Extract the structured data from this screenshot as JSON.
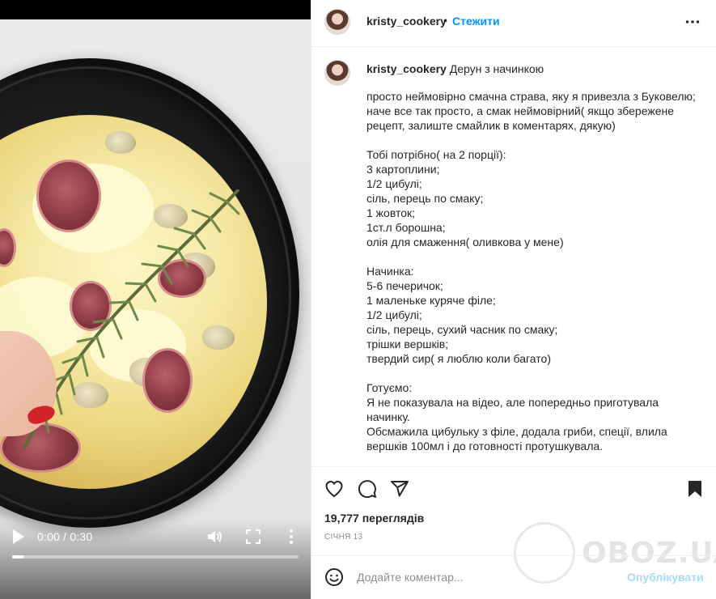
{
  "video": {
    "time_display": "0:00 / 0:30",
    "progress": 0.04,
    "controls": {
      "play_icon": "play-icon",
      "volume_icon": "volume-icon",
      "fullscreen_icon": "fullscreen-icon",
      "more_icon": "more-vertical-icon"
    }
  },
  "header": {
    "username": "kristy_cookery",
    "separator": "•",
    "follow_label": "Стежити",
    "menu_icon": "more-horizontal-icon"
  },
  "caption": {
    "username": "kristy_cookery",
    "title": "Дерун з начинкою",
    "title_suffix": "",
    "body": "просто неймовірно смачна страва, яку я привезла з Буковелю;\nначе все так просто, а смак неймовірний( якщо збережене рецепт, залиште смайлик в коментарях, дякую)\n\nТобі потрібно( на 2 порції):\n3 картоплини;\n1/2 цибулі;\nсіль, перець по смаку;\n1 жовток;\n1ст.л борошна;\nолія для смаження( оливкова у мене)\n\nНачинка:\n5-6 печеричок;\n1 маленьке куряче філе;\n1/2 цибулі;\nсіль, перець, сухий часник по смаку;\nтрішки вершків;\nтвердий сир( я люблю коли багато)\n\nГотуємо:\nЯ не показувала на відео, але попередньо приготувала начинку.\nОбсмажила цибульку з філе, додала гриби, спеції, влила вершків 100мл і до готовності протушкувала."
  },
  "actions": {
    "like_icon": "heart-icon",
    "comment_icon": "comment-icon",
    "share_icon": "send-icon",
    "save_icon": "bookmark-icon"
  },
  "stats": {
    "views": "19,777 переглядів",
    "date": "СІЧНЯ 13"
  },
  "watermark": {
    "text": "OBOZ.UA"
  },
  "comment_bar": {
    "emoji_icon": "emoji-icon",
    "placeholder": "Додайте коментар...",
    "value": "",
    "publish_label": "Опублікувати"
  },
  "colors": {
    "accent": "#0095f6",
    "text": "#262626",
    "muted": "#8e8e8e",
    "border": "#efefef"
  }
}
